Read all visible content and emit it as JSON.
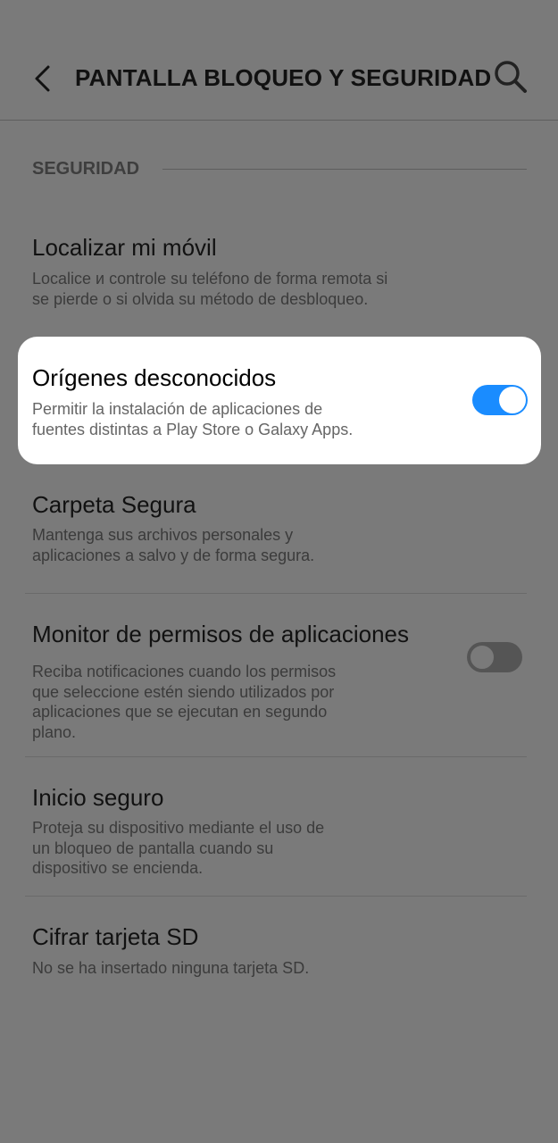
{
  "header": {
    "title": "PANTALLA BLOQUEO Y SEGURIDAD",
    "back_icon": "chevron-left-icon",
    "search_icon": "search-icon"
  },
  "section": {
    "label": "SEGURIDAD"
  },
  "items": [
    {
      "title": "Localizar mi móvil",
      "desc_lines": [
        "Localice и controle su teléfono de forma remota si",
        "se pierde o si olvida su método de desbloqueo."
      ]
    },
    {
      "title": "Orígenes desconocidos",
      "desc_lines": [
        "Permitir la instalación de aplicaciones de",
        "fuentes distintas a Play Store o Galaxy Apps."
      ],
      "toggle_on": true,
      "highlighted": true
    },
    {
      "title": "Carpeta Segura",
      "desc_lines": [
        "Mantenga sus archivos personales y",
        "aplicaciones a salvo y de forma segura."
      ]
    },
    {
      "title": "Monitor de permisos de aplicaciones",
      "desc_lines": [
        "Reciba notificaciones cuando los permisos",
        "que seleccione estén siendo utilizados por",
        "aplicaciones que se ejecutan en segundo",
        "plano."
      ],
      "toggle_on": false
    },
    {
      "title": "Inicio seguro",
      "desc_lines": [
        "Proteja su dispositivo mediante el uso de",
        "un bloqueo de pantalla cuando su",
        "dispositivo se encienda."
      ]
    },
    {
      "title": "Cifrar tarjeta SD",
      "desc_lines": [
        "No se ha insertado ninguna tarjeta SD."
      ]
    }
  ],
  "colors": {
    "overlay": "#7a7a7a",
    "toggle_on": "#1a8cff",
    "card": "#ffffff"
  }
}
